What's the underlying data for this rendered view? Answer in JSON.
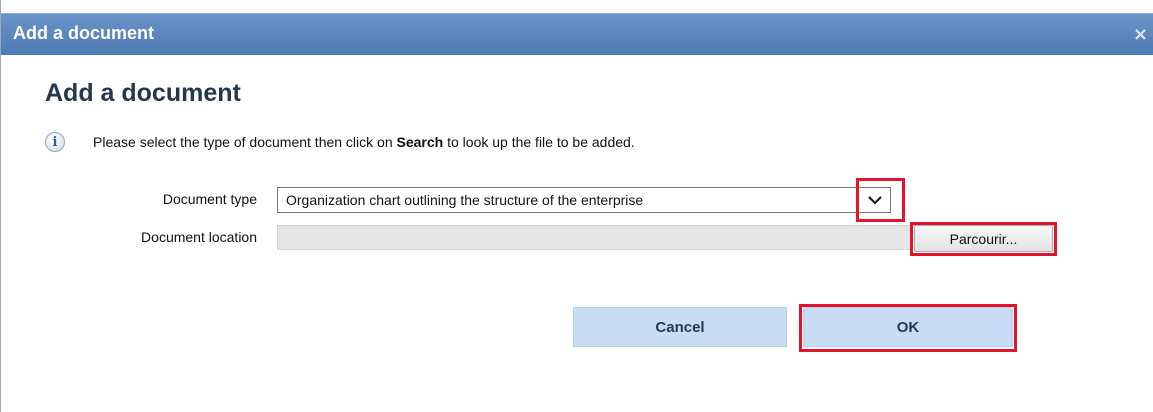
{
  "window": {
    "title": "Add a document",
    "close_glyph": "×"
  },
  "main": {
    "heading": "Add a document",
    "info": {
      "icon": "info-icon",
      "text_before": "Please select the type of document then click on ",
      "text_bold": "Search",
      "text_after": " to look up the file to be added."
    },
    "document_type": {
      "label": "Document type",
      "selected_value": "Organization chart outlining the structure of the enterprise",
      "dropdown_icon": "chevron-down-icon"
    },
    "document_location": {
      "label": "Document location",
      "value": "",
      "browse_label": "Parcourir..."
    }
  },
  "buttons": {
    "cancel_label": "Cancel",
    "ok_label": "OK"
  },
  "colors": {
    "titlebar": "#5a85bd",
    "heading": "#22384f",
    "highlight": "#e3132b",
    "button_bg": "#c8ddf3"
  }
}
